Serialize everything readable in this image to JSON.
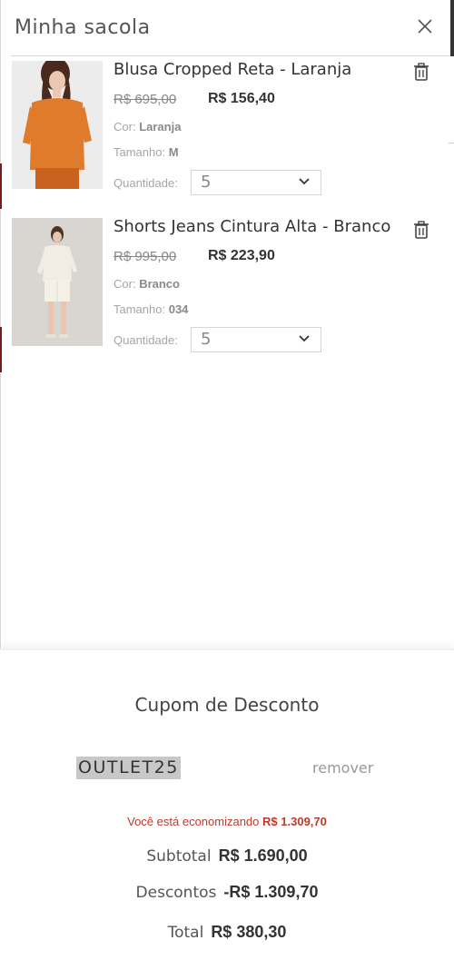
{
  "header": {
    "title": "Minha sacola",
    "close_icon": "close-icon"
  },
  "items": [
    {
      "name": "Blusa Cropped Reta - Laranja",
      "price_old": "R$ 695,00",
      "price_new": "R$ 156,40",
      "color_label": "Cor:",
      "color_value": "Laranja",
      "size_label": "Tamanho:",
      "size_value": "M",
      "qty_label": "Quantidade:",
      "qty_value": "5",
      "thumb_color": "#e07b2c"
    },
    {
      "name": "Shorts Jeans Cintura Alta - Branco",
      "price_old": "R$ 995,00",
      "price_new": "R$ 223,90",
      "color_label": "Cor:",
      "color_value": "Branco",
      "size_label": "Tamanho:",
      "size_value": "034",
      "qty_label": "Quantidade:",
      "qty_value": "5",
      "thumb_color": "#eeeae0"
    }
  ],
  "coupon": {
    "title": "Cupom de Desconto",
    "code": "OUTLET25",
    "remove_label": "remover"
  },
  "totals": {
    "saving_text": "Você está economizando",
    "saving_value": "R$ 1.309,70",
    "subtotal_label": "Subtotal",
    "subtotal_value": "R$ 1.690,00",
    "discount_label": "Descontos",
    "discount_value": "-R$ 1.309,70",
    "total_label": "Total",
    "total_value": "R$ 380,30"
  },
  "colors": {
    "accent_red": "#c0392b"
  }
}
